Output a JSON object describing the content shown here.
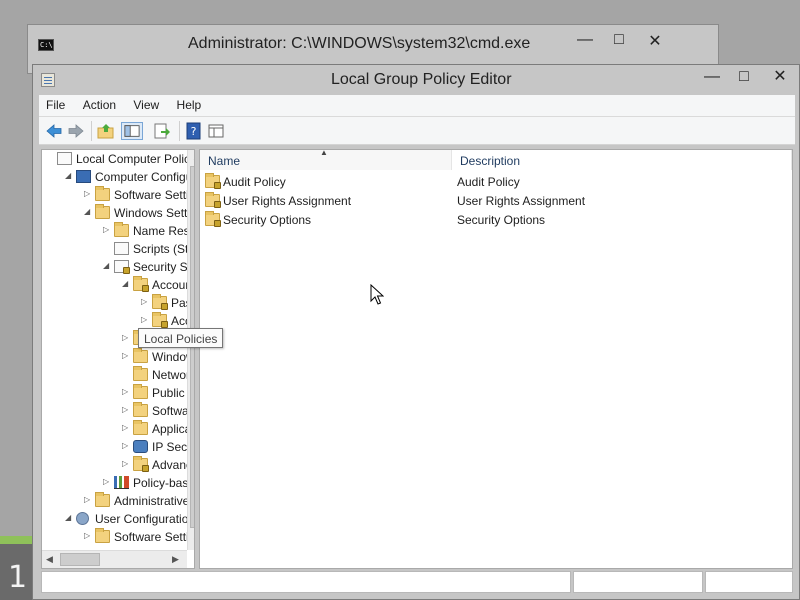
{
  "desktop": {
    "label_number": "1"
  },
  "cmd_window": {
    "title": "Administrator: C:\\WINDOWS\\system32\\cmd.exe",
    "icon_text": "C:\\",
    "controls": [
      "—",
      "□",
      "✕"
    ]
  },
  "gpe_window": {
    "title": "Local Group Policy Editor",
    "controls": [
      "—",
      "□",
      "✕"
    ]
  },
  "menubar": {
    "items": [
      "File",
      "Action",
      "View",
      "Help"
    ]
  },
  "toolbar": {
    "icons": [
      "back-icon",
      "forward-icon",
      "up-folder-icon",
      "show-hide-console-tree-icon",
      "export-list-icon",
      "help-icon",
      "view-icon"
    ]
  },
  "tree": {
    "items": [
      {
        "label": "Local Computer Policy",
        "icon": "doc",
        "expander": "",
        "indent": 0
      },
      {
        "label": "Computer Configuration",
        "icon": "computer",
        "expander": "◢",
        "indent": 1
      },
      {
        "label": "Software Settings",
        "icon": "folder",
        "expander": "▷",
        "indent": 2
      },
      {
        "label": "Windows Settings",
        "icon": "folder",
        "expander": "◢",
        "indent": 2
      },
      {
        "label": "Name Resolution Policy",
        "icon": "folder",
        "expander": "▷",
        "indent": 3
      },
      {
        "label": "Scripts (Startup/Shutdown)",
        "icon": "doc",
        "expander": "",
        "indent": 3
      },
      {
        "label": "Security Settings",
        "icon": "doc-lock",
        "expander": "◢",
        "indent": 3
      },
      {
        "label": "Account Policies",
        "icon": "folder-lock",
        "expander": "◢",
        "indent": 4
      },
      {
        "label": "Password Policy",
        "icon": "folder-lock",
        "expander": "▷",
        "indent": 5
      },
      {
        "label": "Account Lockout Policy",
        "icon": "folder-lock",
        "expander": "▷",
        "indent": 5
      },
      {
        "label": "Local Policies",
        "icon": "folder-lock",
        "expander": "▷",
        "indent": 4
      },
      {
        "label": "Windows Firewall with Advanced Security",
        "icon": "folder",
        "expander": "▷",
        "indent": 4
      },
      {
        "label": "Network List Manager Policies",
        "icon": "folder",
        "expander": "",
        "indent": 4
      },
      {
        "label": "Public Key Policies",
        "icon": "folder",
        "expander": "▷",
        "indent": 4
      },
      {
        "label": "Software Restriction Policies",
        "icon": "folder",
        "expander": "▷",
        "indent": 4
      },
      {
        "label": "Application Control Policies",
        "icon": "folder",
        "expander": "▷",
        "indent": 4
      },
      {
        "label": "IP Security Policies on Local Computer",
        "icon": "ipsec",
        "expander": "▷",
        "indent": 4
      },
      {
        "label": "Advanced Audit Policy Configuration",
        "icon": "folder-lock",
        "expander": "▷",
        "indent": 4
      },
      {
        "label": "Policy-based QoS",
        "icon": "chart",
        "expander": "▷",
        "indent": 3
      },
      {
        "label": "Administrative Templates",
        "icon": "folder",
        "expander": "▷",
        "indent": 2
      },
      {
        "label": "User Configuration",
        "icon": "user",
        "expander": "◢",
        "indent": 1
      },
      {
        "label": "Software Settings",
        "icon": "folder",
        "expander": "▷",
        "indent": 2
      }
    ]
  },
  "tooltip": {
    "text": "Local Policies"
  },
  "list": {
    "columns": [
      "Name",
      "Description"
    ],
    "sort_indicator": "▲",
    "rows": [
      {
        "name": "Audit Policy",
        "description": "Audit Policy"
      },
      {
        "name": "User Rights Assignment",
        "description": "User Rights Assignment"
      },
      {
        "name": "Security Options",
        "description": "Security Options"
      }
    ]
  }
}
